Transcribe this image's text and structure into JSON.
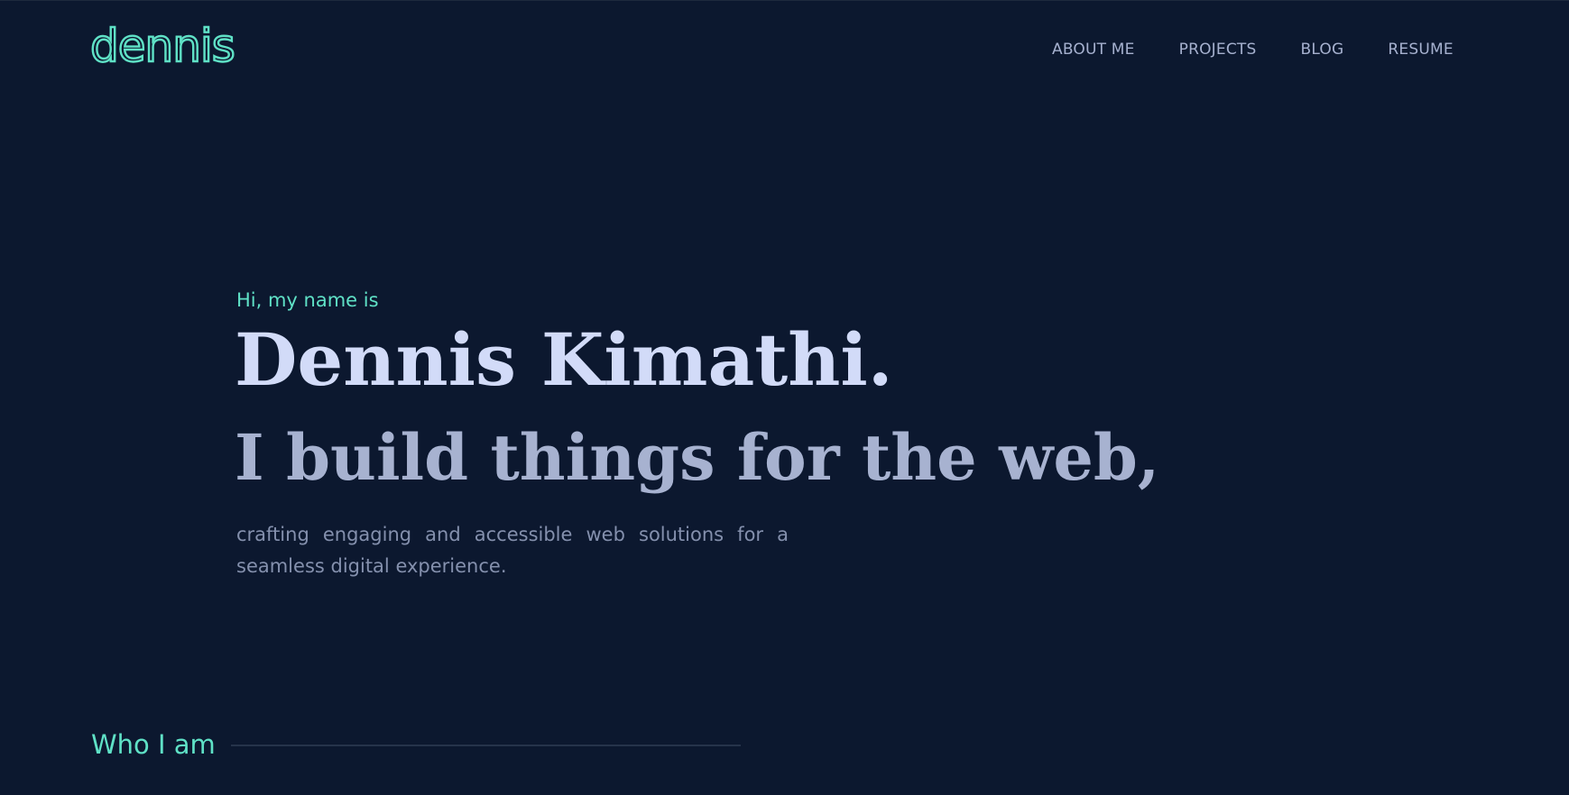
{
  "brand": {
    "logo_text": "dennis",
    "accent_color": "#5fe1c6"
  },
  "nav": {
    "items": [
      {
        "label": "ABOUT ME"
      },
      {
        "label": "PROJECTS"
      },
      {
        "label": "BLOG"
      },
      {
        "label": "RESUME"
      }
    ]
  },
  "hero": {
    "greeting": "Hi, my name is",
    "name": "Dennis Kimathi.",
    "tagline": "I build things for the web,",
    "description": "crafting engaging and accessible web solutions for a seamless digital experience."
  },
  "about": {
    "section_title": "Who I am"
  },
  "colors": {
    "background": "#0c182f",
    "name_text": "#d2dbf8",
    "tagline_text": "#a7b2d0",
    "muted_text": "#8490ad"
  }
}
